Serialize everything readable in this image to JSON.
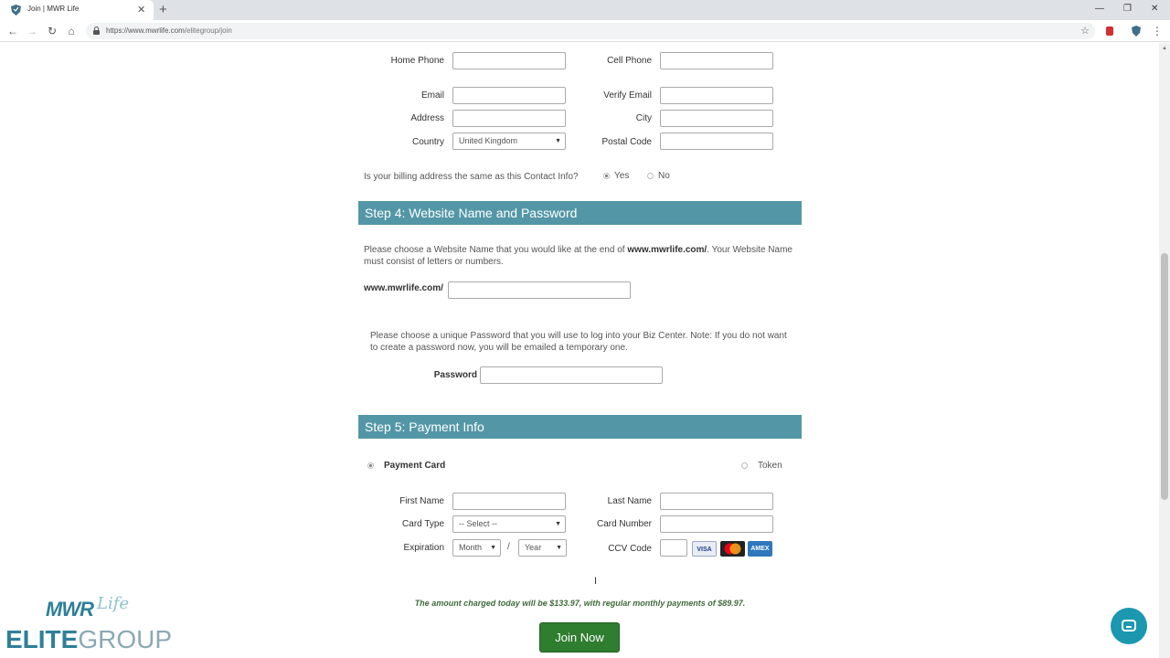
{
  "browser": {
    "tab_title": "Join | MWR Life",
    "tab_close": "✕",
    "new_tab": "+",
    "url_host": "https://www.mwrlife.com",
    "url_path": "/elitegroup/join",
    "nav": {
      "back": "←",
      "forward": "→",
      "reload": "↻",
      "home": "⌂"
    },
    "window": {
      "minimize": "—",
      "restore": "❐",
      "close": "✕"
    },
    "star": "☆",
    "menu": "⋮"
  },
  "contact": {
    "home_phone_label": "Home Phone",
    "cell_phone_label": "Cell Phone",
    "email_label": "Email",
    "verify_email_label": "Verify Email",
    "address_label": "Address",
    "city_label": "City",
    "country_label": "Country",
    "country_value": "United Kingdom",
    "postal_code_label": "Postal Code",
    "billing_question": "Is your billing address the same as this Contact Info?",
    "billing_yes": "Yes",
    "billing_no": "No"
  },
  "step4": {
    "title": "Step 4: Website Name and Password",
    "website_desc_pre": "Please choose a Website Name that you would like at the end of ",
    "website_desc_url": "www.mwrlife.com/",
    "website_desc_post": ". Your Website Name must consist of letters or numbers.",
    "website_prefix": "www.mwrlife.com/",
    "password_desc": "Please choose a unique Password that you will use to log into your Biz Center. Note: If you do not want to create a password now, you will be emailed a temporary one.",
    "password_label": "Password"
  },
  "step5": {
    "title": "Step 5: Payment Info",
    "payment_card": "Payment Card",
    "token": "Token",
    "first_name_label": "First Name",
    "last_name_label": "Last Name",
    "card_type_label": "Card Type",
    "card_type_value": "-- Select --",
    "card_number_label": "Card Number",
    "expiration_label": "Expiration",
    "month_value": "Month",
    "year_value": "Year",
    "slash": "/",
    "ccv_label": "CCV Code",
    "cards": [
      "VISA",
      "MC",
      "AMEX"
    ]
  },
  "charge_notice": "The amount charged today will be $133.97, with regular monthly payments of $89.97.",
  "join_button": "Join Now",
  "logo": {
    "mwr": "MWR",
    "life": "Life",
    "elite": "ELITE",
    "group": "GROUP"
  },
  "colors": {
    "step_header": "#5397a7",
    "join_button": "#2f7d2e",
    "charge_text": "#3e6b3a",
    "brand": "#2f7f98",
    "chat": "#1b98b0"
  }
}
